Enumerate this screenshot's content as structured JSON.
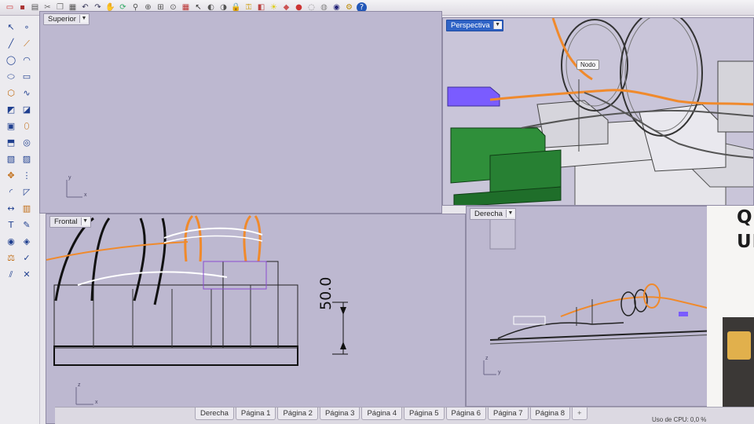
{
  "toolbar": {
    "icons": [
      "open-icon",
      "save-icon",
      "print-icon",
      "cut-icon",
      "copy-icon",
      "paste-icon",
      "undo-icon",
      "redo-icon",
      "hand-pan-icon",
      "rotate-view-icon",
      "zoom-icon",
      "zoom-window-icon",
      "zoom-extents-icon",
      "zoom-selected-icon",
      "grid-viewports-icon",
      "select-icon",
      "show-icon",
      "hide-icon",
      "lock-icon",
      "unlock-icon",
      "layers-icon",
      "light-icon",
      "color-icon",
      "render-sphere-icon",
      "wire-sphere-icon",
      "shaded-sphere-icon",
      "rendered-sphere-icon",
      "options-icon",
      "help-icon"
    ]
  },
  "viewports": {
    "top": {
      "label": "Superior",
      "axis_y": "y",
      "axis_x": "x"
    },
    "perspective": {
      "label": "Perspectiva",
      "node_tag": "Nodo"
    },
    "front": {
      "label": "Frontal",
      "dimension": "50.0",
      "axis_z": "z",
      "axis_x": "x"
    },
    "right": {
      "label": "Derecha",
      "axis_z": "z",
      "axis_y": "y"
    }
  },
  "side_panel": {
    "text_line1": "QU",
    "text_line2": "UI"
  },
  "tabs": [
    "Derecha",
    "Página 1",
    "Página 2",
    "Página 3",
    "Página 4",
    "Página 5",
    "Página 6",
    "Página 7",
    "Página 8",
    "+"
  ],
  "status": {
    "cpu": "Uso de CPU: 0,0 %"
  },
  "colors": {
    "viewport_bg": "#bdb8d0",
    "active_label": "#2f63c6",
    "orange_track": "#f08a2c",
    "green_block": "#2f8f3a",
    "purple_block": "#7a5cff"
  }
}
